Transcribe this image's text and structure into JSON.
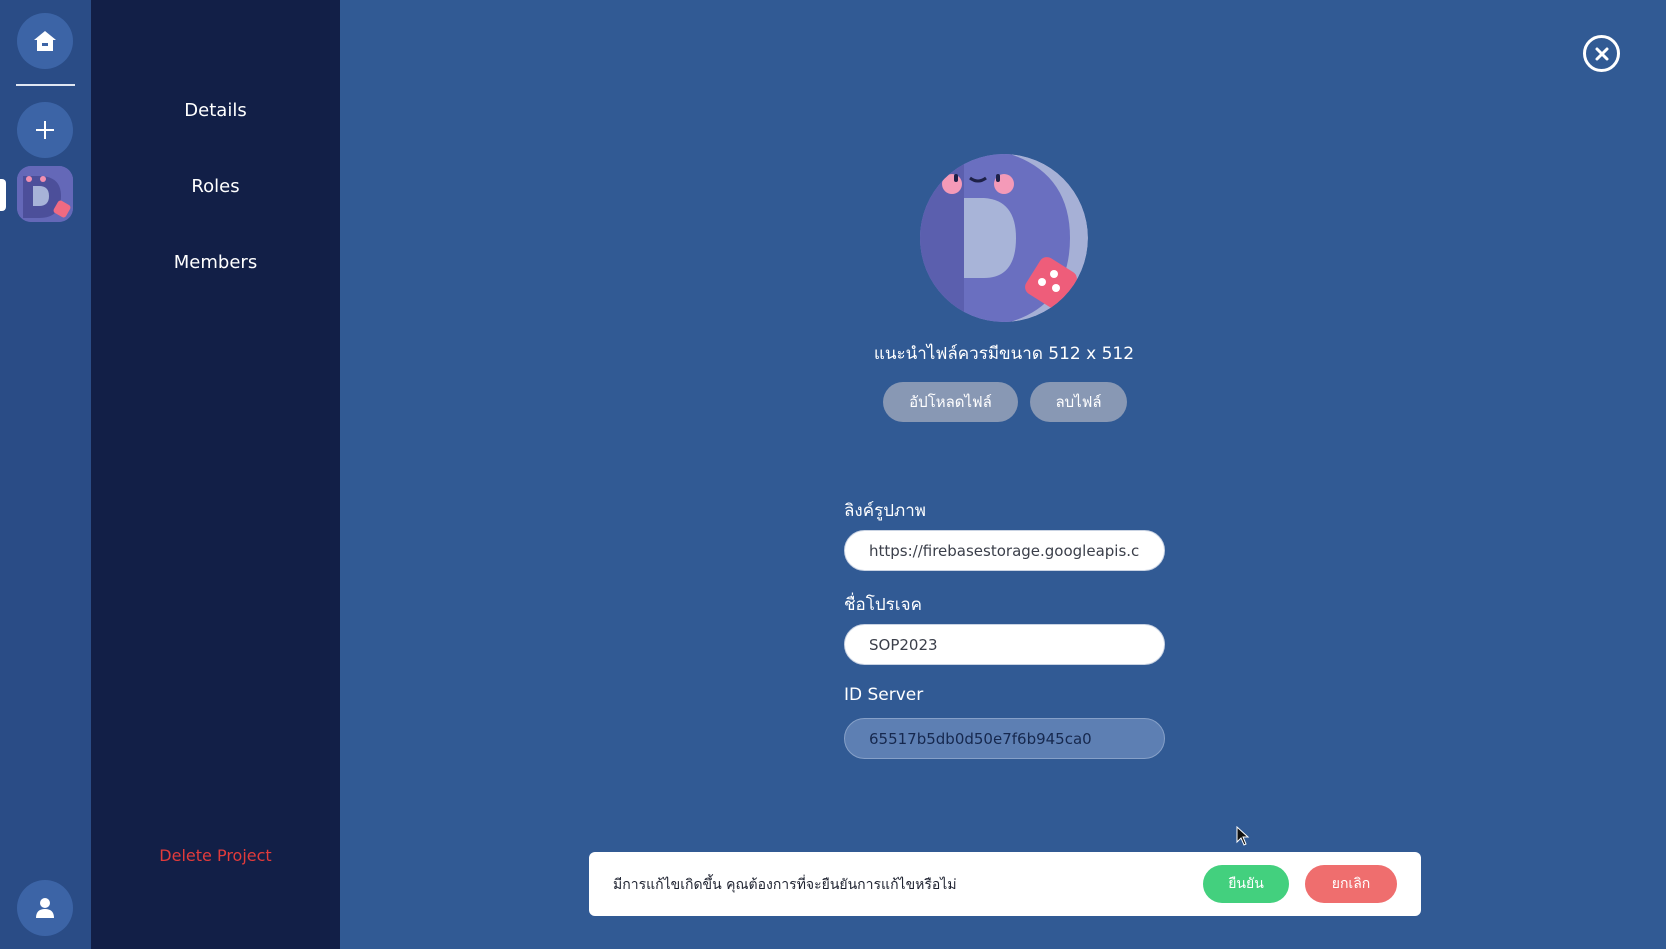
{
  "rail": {
    "home_icon": "home-icon",
    "add_icon": "plus-icon",
    "user_icon": "user-icon"
  },
  "sidebar": {
    "items": [
      {
        "label": "Details"
      },
      {
        "label": "Roles"
      },
      {
        "label": "Members"
      }
    ],
    "delete_label": "Delete Project"
  },
  "main": {
    "image_hint": "แนะนำไฟล์ควรมีขนาด 512 x 512",
    "upload_label": "อัปโหลดไฟล์",
    "remove_label": "ลบไฟล์",
    "image_url_label": "ลิงค์รูปภาพ",
    "image_url_value": "https://firebasestorage.googleapis.c",
    "project_name_label": "ชื่อโปรเจค",
    "project_name_value": "SOP2023",
    "server_id_label": "ID Server",
    "server_id_value": "65517b5db0d50e7f6b945ca0"
  },
  "notice": {
    "message": "มีการแก้ไขเกิดขึ้น คุณต้องการที่จะยืนยันการแก้ไขหรือไม่",
    "confirm_label": "ยืนยัน",
    "cancel_label": "ยกเลิก"
  },
  "colors": {
    "background": "#315a94",
    "rail": "#2a4c86",
    "sidebar": "#121f47",
    "danger": "#e23b3b",
    "confirm": "#43d07e",
    "cancel": "#ef6e6e"
  }
}
